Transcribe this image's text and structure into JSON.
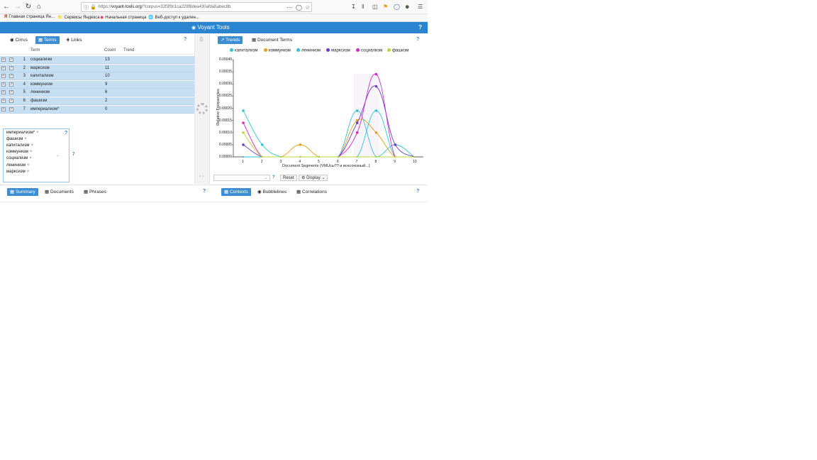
{
  "browser": {
    "url_prefix": "https://",
    "url_domain": "voyant-tools.org",
    "url_rest": "/?corpus=32f3f9c1ca229f8dea430afda5abec8b",
    "bookmarks": [
      "Главная страница Ян...",
      "Сервисы Яндекса",
      "Начальная страница",
      "Веб-доступ к удален..."
    ]
  },
  "app": {
    "title": "Voyant Tools",
    "help": "?"
  },
  "left_panel": {
    "tabs": [
      "Cirrus",
      "Terms",
      "Links"
    ],
    "active_tab": "Terms",
    "columns": {
      "term": "Term",
      "count": "Count",
      "trend": "Trend"
    },
    "rows": [
      {
        "n": "1",
        "term": "социализм",
        "count": "13"
      },
      {
        "n": "2",
        "term": "марксизм",
        "count": "11"
      },
      {
        "n": "3",
        "term": "капитализм",
        "count": "10"
      },
      {
        "n": "4",
        "term": "коммунизм",
        "count": "9"
      },
      {
        "n": "5",
        "term": "ленинизм",
        "count": "6"
      },
      {
        "n": "6",
        "term": "фашизм",
        "count": "2"
      },
      {
        "n": "7",
        "term": "империализм*",
        "count": "0"
      }
    ],
    "query_tags": [
      "империализм*",
      "фашизм",
      "капитализм",
      "коммунизм",
      "социализм",
      "ленинизм",
      "марксизм"
    ],
    "query_count": "7",
    "help": "?"
  },
  "right_panel": {
    "tabs": [
      "Trends",
      "Document Terms"
    ],
    "active_tab": "Trends",
    "help": "?",
    "reset_label": "Reset",
    "display_label": "Display"
  },
  "bottom_left": {
    "tabs": [
      "Summary",
      "Documents",
      "Phrases"
    ],
    "active_tab": "Summary",
    "help": "?"
  },
  "bottom_right": {
    "tabs": [
      "Contexts",
      "Bubblelines",
      "Correlations"
    ],
    "active_tab": "Contexts",
    "help": "?"
  },
  "colors": {
    "header": "#2a84d0",
    "капитализм": "#2ec7d4",
    "коммунизм": "#e2a21c",
    "ленинизм": "#36bcd9",
    "марксизм": "#6a3cc7",
    "социализм": "#cc2fc9",
    "фашизм": "#b9d93b"
  },
  "chart_data": {
    "type": "line",
    "title": "",
    "xlabel": "Document Segments (VMUсы?? и всесоюзный...)",
    "ylabel": "Relative Frequencies",
    "x": [
      1,
      2,
      3,
      4,
      5,
      6,
      7,
      8,
      9,
      10
    ],
    "ylim": [
      0,
      0.0004
    ],
    "yticks": [
      "0.00000",
      "0.00005",
      "0.00010",
      "0.00015",
      "0.00020",
      "0.00025",
      "0.00030",
      "0.00035",
      "0.00040"
    ],
    "legend_position": "top",
    "series": [
      {
        "name": "капитализм",
        "values": [
          0.00019,
          5e-05,
          0,
          0,
          0,
          0,
          0,
          0.00019,
          0,
          0
        ]
      },
      {
        "name": "коммунизм",
        "values": [
          0,
          0,
          0,
          5e-05,
          0,
          0,
          0.00015,
          0.0001,
          0,
          0
        ]
      },
      {
        "name": "ленинизм",
        "values": [
          0,
          0,
          0,
          0,
          0,
          0,
          0.00019,
          0,
          5e-05,
          0
        ]
      },
      {
        "name": "марксизм",
        "values": [
          5e-05,
          0,
          0,
          0,
          0,
          0,
          0.00014,
          0.00029,
          5e-05,
          0
        ]
      },
      {
        "name": "социализм",
        "values": [
          0.00014,
          0,
          0,
          0,
          0,
          0,
          0.0001,
          0.00034,
          0,
          0
        ]
      },
      {
        "name": "фашизм",
        "values": [
          0.0001,
          0,
          0,
          0,
          0,
          0,
          0,
          0,
          0,
          0
        ]
      }
    ]
  }
}
